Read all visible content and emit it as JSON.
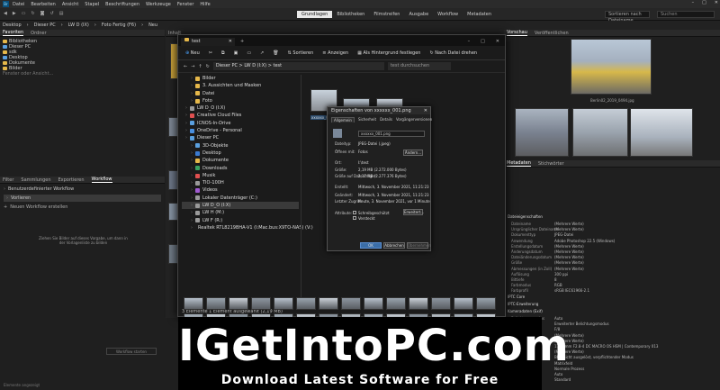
{
  "menubar": {
    "logo": "Br",
    "items": [
      "Datei",
      "Bearbeiten",
      "Ansicht",
      "Stapel",
      "Beschriftungen",
      "Werkzeuge",
      "Fenster",
      "Hilfe"
    ]
  },
  "toolbar": {
    "workspaces": [
      "Grundlagen",
      "Bibliotheken",
      "Filmstreifen",
      "Ausgabe",
      "Workflow",
      "Metadaten"
    ],
    "active_workspace": "Grundlagen",
    "sort": "Sortieren nach Dateiname",
    "search_placeholder": "Suchen"
  },
  "path": [
    "Desktop",
    "Dieser PC",
    "LW D (IX)",
    "Foto Fertig (F6)",
    "Neu"
  ],
  "left_panel": {
    "tabs": [
      "Favoriten",
      "Ordner"
    ],
    "folders": [
      "Bibliotheken",
      "Dieser PC",
      "sdk",
      "Desktop",
      "Dokumente",
      "Bilder",
      "Fenster oder Ansicht..."
    ]
  },
  "content_header": "Inhalt",
  "workflow_panel": {
    "tabs": [
      "Filter",
      "Sammlungen",
      "Exportieren",
      "Workflow"
    ],
    "active_tab": "Workflow",
    "items": [
      "Benutzerdefinierter Workflow",
      "Vorlieren",
      "Neuen Workflow erstellen"
    ],
    "hint": "Ziehen Sie Bilder auf dieses Vorgabe, um dann in der Vorlagenliste zu bilden",
    "bottom_button": "Workflow starten"
  },
  "explorer": {
    "tab_title": "test",
    "commands": [
      "Neu",
      "Sortieren",
      "Anzeigen",
      "Als Hintergrund festlegen",
      "Nach Datei drehen"
    ],
    "address": "Dieser PC > LW D (I:X) > test",
    "search_placeholder": "test durchsuchen",
    "tree": [
      "Bilder",
      "3. Aussichten und Masken",
      "Datei",
      "Foto",
      "LW D_O (I:X)",
      "Creative Cloud Files",
      "ICNOS-In-Drive",
      "OneDrive - Personal",
      "Dieser PC",
      "3D-Objekte",
      "Desktop",
      "Dokumente",
      "Downloads",
      "Musik",
      "TIO-100H",
      "Videos",
      "Lokaler Datenträger (C:)",
      "LW D_O (I:X)",
      "LW H (M:)",
      "LW F (R:)",
      "Realtek RTL8219BHA-V1 (I:Mac.bus:X9TO-NAS) (V:)"
    ],
    "files": [
      "xxxxxx_001.png"
    ],
    "status": "3 Elemente   1 Element ausgewählt (2,19 MB)"
  },
  "properties_dialog": {
    "title": "Eigenschaften von xxxxxx_001.png",
    "tabs": [
      "Allgemein",
      "Sicherheit",
      "Details",
      "Vorgängerversionen"
    ],
    "filename": "xxxxxx_001.png",
    "rows": [
      {
        "label": "Dateityp:",
        "value": "JPEG-Datei (.jpeg)"
      },
      {
        "label": "Öffnen mit:",
        "value": "Fotos"
      },
      {
        "label": "Ort:",
        "value": "I:\\test"
      },
      {
        "label": "Größe:",
        "value": "2,19 MB (2.272.000 Bytes)"
      },
      {
        "label": "Größe auf Datenträger:",
        "value": "2,17 MB (2.277.376 Bytes)"
      },
      {
        "label": "Erstellt:",
        "value": "Mittwoch, 3. November 2021, 11:21:23"
      },
      {
        "label": "Geändert:",
        "value": "Mittwoch, 3. November 2021, 11:21:23"
      },
      {
        "label": "Letzter Zugriff:",
        "value": "Heute, 3. November 2021, vor 1 Minute"
      },
      {
        "label": "Attribute:",
        "value": "Schreibgeschützt"
      },
      {
        "label": "",
        "value": "Versteckt"
      }
    ],
    "change_button": "Ändern...",
    "advanced_button": "Erweitert...",
    "ok": "OK",
    "cancel": "Abbrechen",
    "apply": "Übernehmen"
  },
  "preview": {
    "tabs": [
      "Vorschau",
      "Veröffentlichen"
    ],
    "captions": [
      "Berlin02_2019_0494.jpg",
      "Berlin02_2019_0495.jpg",
      "Berlin02_2019_0496.jpg"
    ]
  },
  "metadata": {
    "tabs": [
      "Metadaten",
      "Stichwörter"
    ],
    "section": "Dateieigenschaften",
    "rows": [
      {
        "k": "Dateiname",
        "v": "(Mehrere Werte)"
      },
      {
        "k": "Ursprünglicher Dateiname",
        "v": "(Mehrere Werte)"
      },
      {
        "k": "Dokumenttyp",
        "v": "JPEG-Datei"
      },
      {
        "k": "Anwendung",
        "v": "Adobe Photoshop 22.5 (Windows)"
      },
      {
        "k": "Erstellungsdatum",
        "v": "(Mehrere Werte)"
      },
      {
        "k": "Änderungsdatum",
        "v": "(Mehrere Werte)"
      },
      {
        "k": "Dateiänderungsdatum",
        "v": "(Mehrere Werte)"
      },
      {
        "k": "Größe",
        "v": "(Mehrere Werte)"
      },
      {
        "k": "Abmessungen (in Zoll)",
        "v": "(Mehrere Werte)"
      },
      {
        "k": "Auflösung",
        "v": "300 ppi"
      },
      {
        "k": "Bittiefe",
        "v": "8"
      },
      {
        "k": "Farbmodus",
        "v": "RGB"
      },
      {
        "k": "Farbprofil",
        "v": "sRGB IEC61966-2.1"
      }
    ],
    "section2": "IPTC Core",
    "section3": "IPTC-Erweiterung",
    "section4": "Kameradaten (Exif)",
    "rows2": [
      {
        "k": "Belichtungsmodus",
        "v": "Auto"
      },
      {
        "k": "",
        "v": "Erweiterter Belichtungsmodus"
      },
      {
        "k": "",
        "v": "F/8"
      },
      {
        "k": "",
        "v": "(Mehrere Werte)"
      },
      {
        "k": "",
        "v": "(Mehrere Werte)"
      },
      {
        "k": "",
        "v": "17-70mm F2.8-4 DC MACRO OS HSM | Contemporary 013"
      },
      {
        "k": "",
        "v": "(Mehrere Werte)"
      },
      {
        "k": "",
        "v": "Blitz nicht ausgelöst, verpflichtender Modus"
      },
      {
        "k": "",
        "v": "Matrixfeld"
      },
      {
        "k": "",
        "v": "Normale Prozess"
      },
      {
        "k": "",
        "v": "Auto"
      },
      {
        "k": "",
        "v": "Standard"
      }
    ]
  },
  "statusbar": "Elemente angezeigt",
  "banner": {
    "title": "IGetIntoPC.com",
    "subtitle": "Download Latest Software for Free"
  }
}
